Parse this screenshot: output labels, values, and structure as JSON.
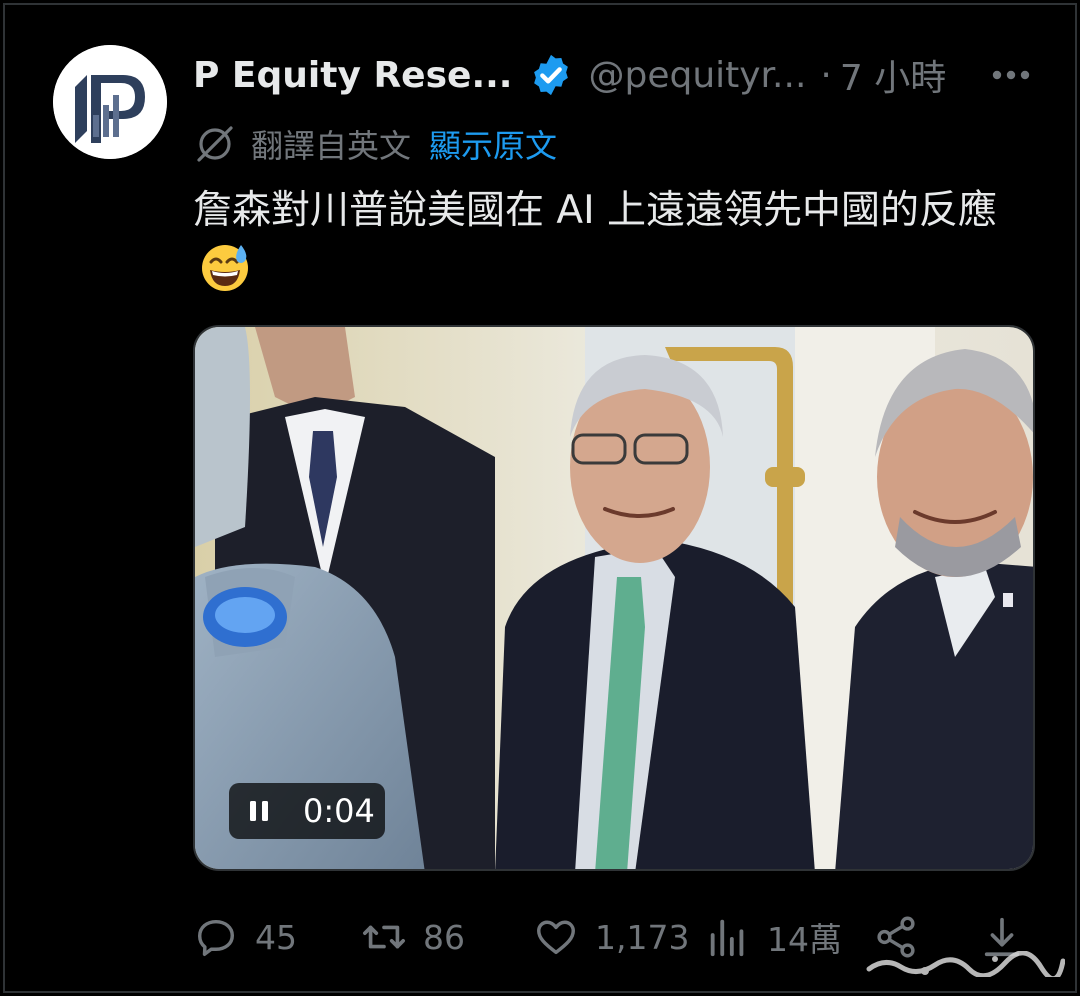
{
  "tweet": {
    "author": {
      "display_name": "P Equity Rese...",
      "handle": "@pequityr...",
      "separator": "·",
      "time": "7 小時",
      "verified": true,
      "avatar_icon": "pequity-logo"
    },
    "translation": {
      "label": "翻譯自英文",
      "show_original": "顯示原文",
      "icon": "translate-globe-icon"
    },
    "text": "詹森對川普說美國在 AI 上遠遠領先中國的反應",
    "emoji": "grinning-sweat-emoji",
    "video": {
      "time": "0:04",
      "state": "playing",
      "control_icon": "pause-icon"
    },
    "actions": {
      "replies": "45",
      "reposts": "86",
      "likes": "1,173",
      "views": "14萬"
    }
  },
  "colors": {
    "background": "#000000",
    "text_primary": "#e7e9ea",
    "text_secondary": "#71767b",
    "link": "#1d9bf0",
    "verified_badge": "#1d9bf0"
  }
}
